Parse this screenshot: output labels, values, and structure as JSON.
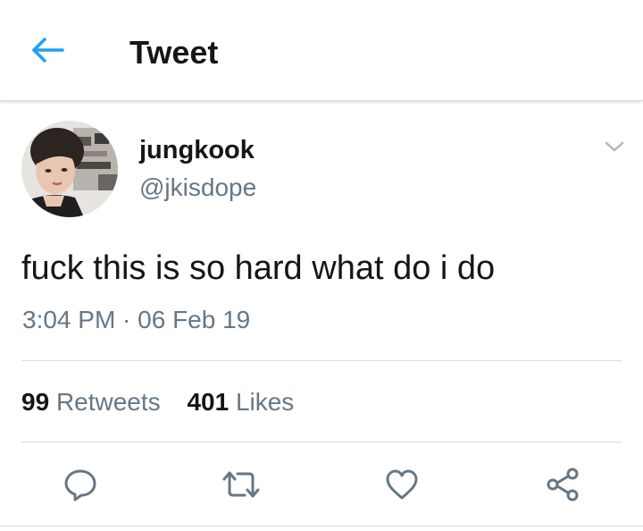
{
  "header": {
    "title": "Tweet",
    "back_icon": "arrow-left-icon",
    "accent_color": "#1da1f2"
  },
  "tweet": {
    "display_name": "jungkook",
    "handle": "@jkisdope",
    "text": "fuck this is so hard what do i do",
    "timestamp": "3:04 PM · 06 Feb 19",
    "menu_icon": "chevron-down-icon"
  },
  "stats": {
    "retweets": {
      "count": "99",
      "label": "Retweets"
    },
    "likes": {
      "count": "401",
      "label": "Likes"
    }
  },
  "actions": [
    {
      "name": "reply",
      "icon": "reply-icon"
    },
    {
      "name": "retweet",
      "icon": "retweet-icon"
    },
    {
      "name": "like",
      "icon": "heart-icon"
    },
    {
      "name": "share",
      "icon": "share-icon"
    }
  ],
  "colors": {
    "text_primary": "#14171a",
    "text_secondary": "#657786",
    "icon_gray": "#657786",
    "divider": "#d8dde1"
  }
}
